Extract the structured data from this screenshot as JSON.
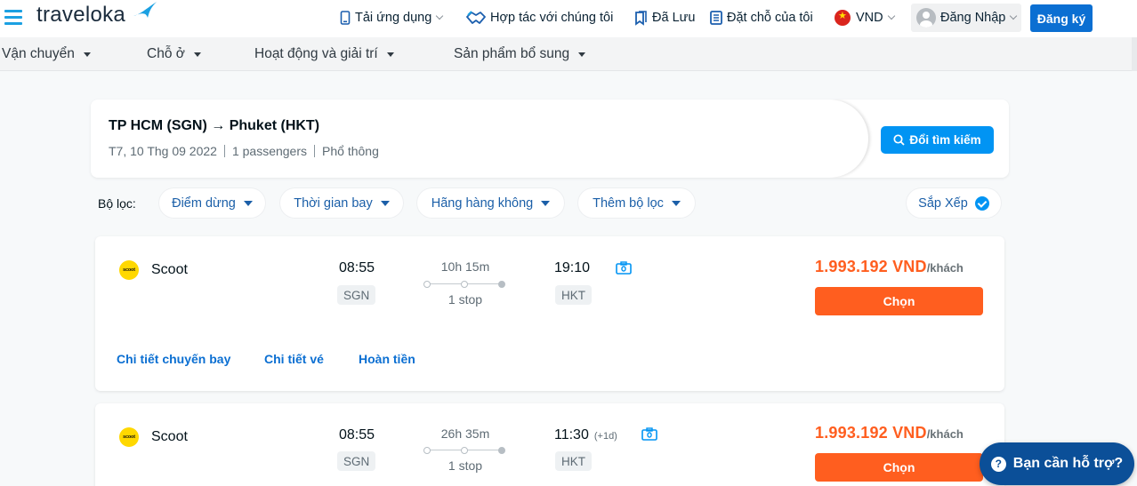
{
  "header": {
    "logo_text": "traveloka",
    "nav": [
      {
        "label": "Tải ứng dụng",
        "icon": "phone-icon",
        "has_dropdown": true
      },
      {
        "label": "Hợp tác với chúng tôi",
        "icon": "handshake-icon",
        "has_dropdown": false
      },
      {
        "label": "Đã Lưu",
        "icon": "bookmark-icon",
        "has_dropdown": false
      },
      {
        "label": "Đặt chỗ của tôi",
        "icon": "booking-list-icon",
        "has_dropdown": false
      }
    ],
    "currency": "VND",
    "login_label": "Đăng Nhập",
    "register_label": "Đăng ký"
  },
  "subnav": {
    "items": [
      {
        "label": "Vận chuyển"
      },
      {
        "label": "Chỗ ở"
      },
      {
        "label": "Hoạt động và giải trí"
      },
      {
        "label": "Sản phẩm bổ sung"
      }
    ]
  },
  "search": {
    "route": "TP HCM (SGN) → Phuket (HKT)",
    "date": "T7, 10 Thg 09 2022",
    "passengers": "1 passengers",
    "cabin": "Phổ thông",
    "change_button": "Đổi tìm kiếm"
  },
  "filters": {
    "label": "Bộ lọc:",
    "chips": [
      {
        "label": "Điểm dừng"
      },
      {
        "label": "Thời gian bay"
      },
      {
        "label": "Hãng hàng không"
      },
      {
        "label": "Thêm bộ lọc"
      }
    ],
    "sort_label": "Sắp Xếp"
  },
  "flights": [
    {
      "airline": "Scoot",
      "airline_logo_text": "scoot",
      "depart_time": "08:55",
      "depart_airport": "SGN",
      "duration": "10h 15m",
      "stops": "1 stop",
      "arrive_time": "19:10",
      "arrive_day_offset": "",
      "arrive_airport": "HKT",
      "price": "1.993.192 VND",
      "per_pax": "/khách",
      "choose_label": "Chọn",
      "links": [
        "Chi tiết chuyến bay",
        "Chi tiết vé",
        "Hoàn tiền"
      ]
    },
    {
      "airline": "Scoot",
      "airline_logo_text": "scoot",
      "depart_time": "08:55",
      "depart_airport": "SGN",
      "duration": "26h 35m",
      "stops": "1 stop",
      "arrive_time": "11:30",
      "arrive_day_offset": "(+1d)",
      "arrive_airport": "HKT",
      "price": "1.993.192 VND",
      "per_pax": "/khách",
      "choose_label": "Chọn"
    }
  ],
  "help": {
    "label": "Bạn cần hỗ trợ?"
  },
  "colors": {
    "brand_blue": "#0194f3",
    "price_orange": "#ff5e1f",
    "register_blue": "#0b6fd2",
    "help_navy": "#0b4f98"
  }
}
